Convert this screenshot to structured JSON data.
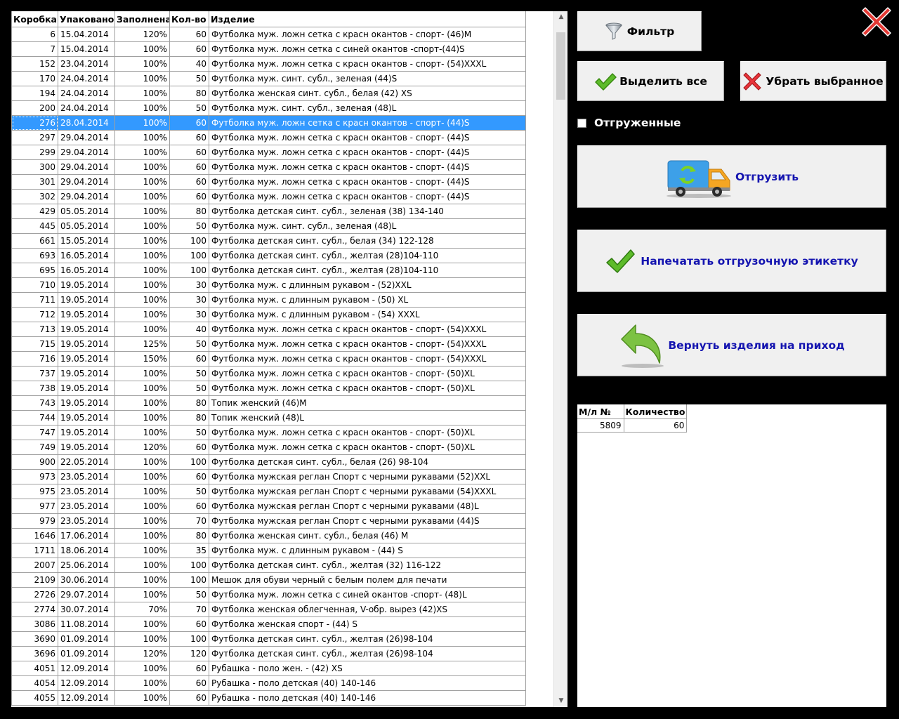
{
  "grid": {
    "columns": [
      "Коробка",
      "Упаковано",
      "Заполнена",
      "Кол-во",
      "Изделие"
    ],
    "selected_index": 6,
    "rows": [
      [
        "6",
        "15.04.2014",
        "120%",
        "60",
        "Футболка муж.  ложн сетка с красн окантов - спорт- (46)M"
      ],
      [
        "7",
        "15.04.2014",
        "100%",
        "60",
        "Футболка муж. ложн сетка с синей окантов -спорт-(44)S"
      ],
      [
        "152",
        "23.04.2014",
        "100%",
        "40",
        "Футболка муж. ложн сетка с красн окантов - спорт- (54)XXXL"
      ],
      [
        "170",
        "24.04.2014",
        "100%",
        "50",
        "Футболка муж. синт. субл., зеленая (44)S"
      ],
      [
        "194",
        "24.04.2014",
        "100%",
        "80",
        "Футболка женская синт. субл., белая (42) XS"
      ],
      [
        "200",
        "24.04.2014",
        "100%",
        "50",
        "Футболка муж. синт. субл., зеленая (48)L"
      ],
      [
        "276",
        "28.04.2014",
        "100%",
        "60",
        "Футболка муж.  ложн сетка с красн окантов - спорт- (44)S"
      ],
      [
        "297",
        "29.04.2014",
        "100%",
        "60",
        "Футболка муж.  ложн сетка с красн окантов - спорт- (44)S"
      ],
      [
        "299",
        "29.04.2014",
        "100%",
        "60",
        "Футболка муж.  ложн сетка с красн окантов - спорт- (44)S"
      ],
      [
        "300",
        "29.04.2014",
        "100%",
        "60",
        "Футболка муж.  ложн сетка с красн окантов - спорт- (44)S"
      ],
      [
        "301",
        "29.04.2014",
        "100%",
        "60",
        "Футболка муж.  ложн сетка с красн окантов - спорт- (44)S"
      ],
      [
        "302",
        "29.04.2014",
        "100%",
        "60",
        "Футболка муж.  ложн сетка с красн окантов - спорт- (44)S"
      ],
      [
        "429",
        "05.05.2014",
        "100%",
        "80",
        "Футболка детская синт. субл., зеленая (38) 134-140"
      ],
      [
        "445",
        "05.05.2014",
        "100%",
        "50",
        "Футболка муж. синт. субл., зеленая (48)L"
      ],
      [
        "661",
        "15.05.2014",
        "100%",
        "100",
        "Футболка детская синт. субл., белая (34) 122-128"
      ],
      [
        "693",
        "16.05.2014",
        "100%",
        "100",
        "Футболка детская синт. субл., желтая (28)104-110"
      ],
      [
        "695",
        "16.05.2014",
        "100%",
        "100",
        "Футболка детская синт. субл., желтая (28)104-110"
      ],
      [
        "710",
        "19.05.2014",
        "100%",
        "30",
        "Футболка муж. с длинным рукавом - (52)XXL"
      ],
      [
        "711",
        "19.05.2014",
        "100%",
        "30",
        "Футболка муж. с длинным рукавом - (50) XL"
      ],
      [
        "712",
        "19.05.2014",
        "100%",
        "30",
        "Футболка муж. с длинным рукавом - (54) XXXL"
      ],
      [
        "713",
        "19.05.2014",
        "100%",
        "40",
        "Футболка муж. ложн сетка с красн окантов - спорт- (54)XXXL"
      ],
      [
        "715",
        "19.05.2014",
        "125%",
        "50",
        "Футболка муж. ложн сетка с красн окантов - спорт- (54)XXXL"
      ],
      [
        "716",
        "19.05.2014",
        "150%",
        "60",
        "Футболка муж. ложн сетка с красн окантов - спорт- (54)XXXL"
      ],
      [
        "737",
        "19.05.2014",
        "100%",
        "50",
        "Футболка муж.  ложн сетка с красн окантов - спорт- (50)XL"
      ],
      [
        "738",
        "19.05.2014",
        "100%",
        "50",
        "Футболка муж.  ложн сетка с красн окантов - спорт- (50)XL"
      ],
      [
        "743",
        "19.05.2014",
        "100%",
        "80",
        "Топик женский (46)M"
      ],
      [
        "744",
        "19.05.2014",
        "100%",
        "80",
        "Топик женский (48)L"
      ],
      [
        "747",
        "19.05.2014",
        "100%",
        "50",
        "Футболка муж.  ложн сетка с красн окантов - спорт- (50)XL"
      ],
      [
        "749",
        "19.05.2014",
        "120%",
        "60",
        "Футболка муж.  ложн сетка с красн окантов - спорт- (50)XL"
      ],
      [
        "900",
        "22.05.2014",
        "100%",
        "100",
        "Футболка детская синт. субл., белая (26) 98-104"
      ],
      [
        "973",
        "23.05.2014",
        "100%",
        "60",
        "Футболка мужская реглан Спорт с черными рукавами (52)XXL"
      ],
      [
        "975",
        "23.05.2014",
        "100%",
        "50",
        "Футболка мужская реглан Спорт с черными рукавами (54)XXXL"
      ],
      [
        "977",
        "23.05.2014",
        "100%",
        "60",
        "Футболка мужская реглан Спорт с черными рукавами (48)L"
      ],
      [
        "979",
        "23.05.2014",
        "100%",
        "70",
        "Футболка мужская реглан Спорт с черными рукавами (44)S"
      ],
      [
        "1646",
        "17.06.2014",
        "100%",
        "80",
        "Футболка женская синт. субл., белая (46) M"
      ],
      [
        "1711",
        "18.06.2014",
        "100%",
        "35",
        "Футболка муж. с длинным рукавом - (44) S"
      ],
      [
        "2007",
        "25.06.2014",
        "100%",
        "100",
        "Футболка детская синт. субл., желтая (32) 116-122"
      ],
      [
        "2109",
        "30.06.2014",
        "100%",
        "100",
        "Мешок для обуви черный с белым полем для печати"
      ],
      [
        "2726",
        "29.07.2014",
        "100%",
        "50",
        "Футболка муж. ложн сетка с синей окантов -спорт- (48)L"
      ],
      [
        "2774",
        "30.07.2014",
        "70%",
        "70",
        "Футболка женская облегченная, V-обр. вырез (42)XS"
      ],
      [
        "3086",
        "11.08.2014",
        "100%",
        "60",
        "Футболка женская спорт - (44) S"
      ],
      [
        "3690",
        "01.09.2014",
        "100%",
        "100",
        "Футболка детская синт. субл., желтая (26)98-104"
      ],
      [
        "3696",
        "01.09.2014",
        "120%",
        "120",
        "Футболка детская синт. субл., желтая (26)98-104"
      ],
      [
        "4051",
        "12.09.2014",
        "100%",
        "60",
        "Рубашка - поло жен. - (42) XS"
      ],
      [
        "4054",
        "12.09.2014",
        "100%",
        "60",
        "Рубашка - поло детская (40) 140-146"
      ],
      [
        "4055",
        "12.09.2014",
        "100%",
        "60",
        "Рубашка - поло детская (40) 140-146"
      ]
    ]
  },
  "buttons": {
    "filter": "Фильтр",
    "select_all": "Выделить все",
    "remove_selected": "Убрать выбранное",
    "ship": "Отгрузить",
    "print_label": "Напечатать отгрузочную этикетку",
    "return_items": "Вернуть изделия на приход"
  },
  "shipped_checkbox": {
    "label": "Отгруженные",
    "checked": false
  },
  "ml_table": {
    "columns": [
      "М/л №",
      "Количество"
    ],
    "rows": [
      [
        "5809",
        "60"
      ]
    ]
  },
  "icons": {
    "filter": "funnel-icon",
    "select_all": "green-check-icon",
    "remove_selected": "red-x-icon",
    "ship": "truck-icon",
    "print_label": "green-check-icon",
    "return_items": "return-arrow-icon",
    "close": "close-icon"
  },
  "colors": {
    "selection": "#3399ff",
    "button_text_blue": "#1515b0",
    "button_face": "#f0f0f0"
  }
}
